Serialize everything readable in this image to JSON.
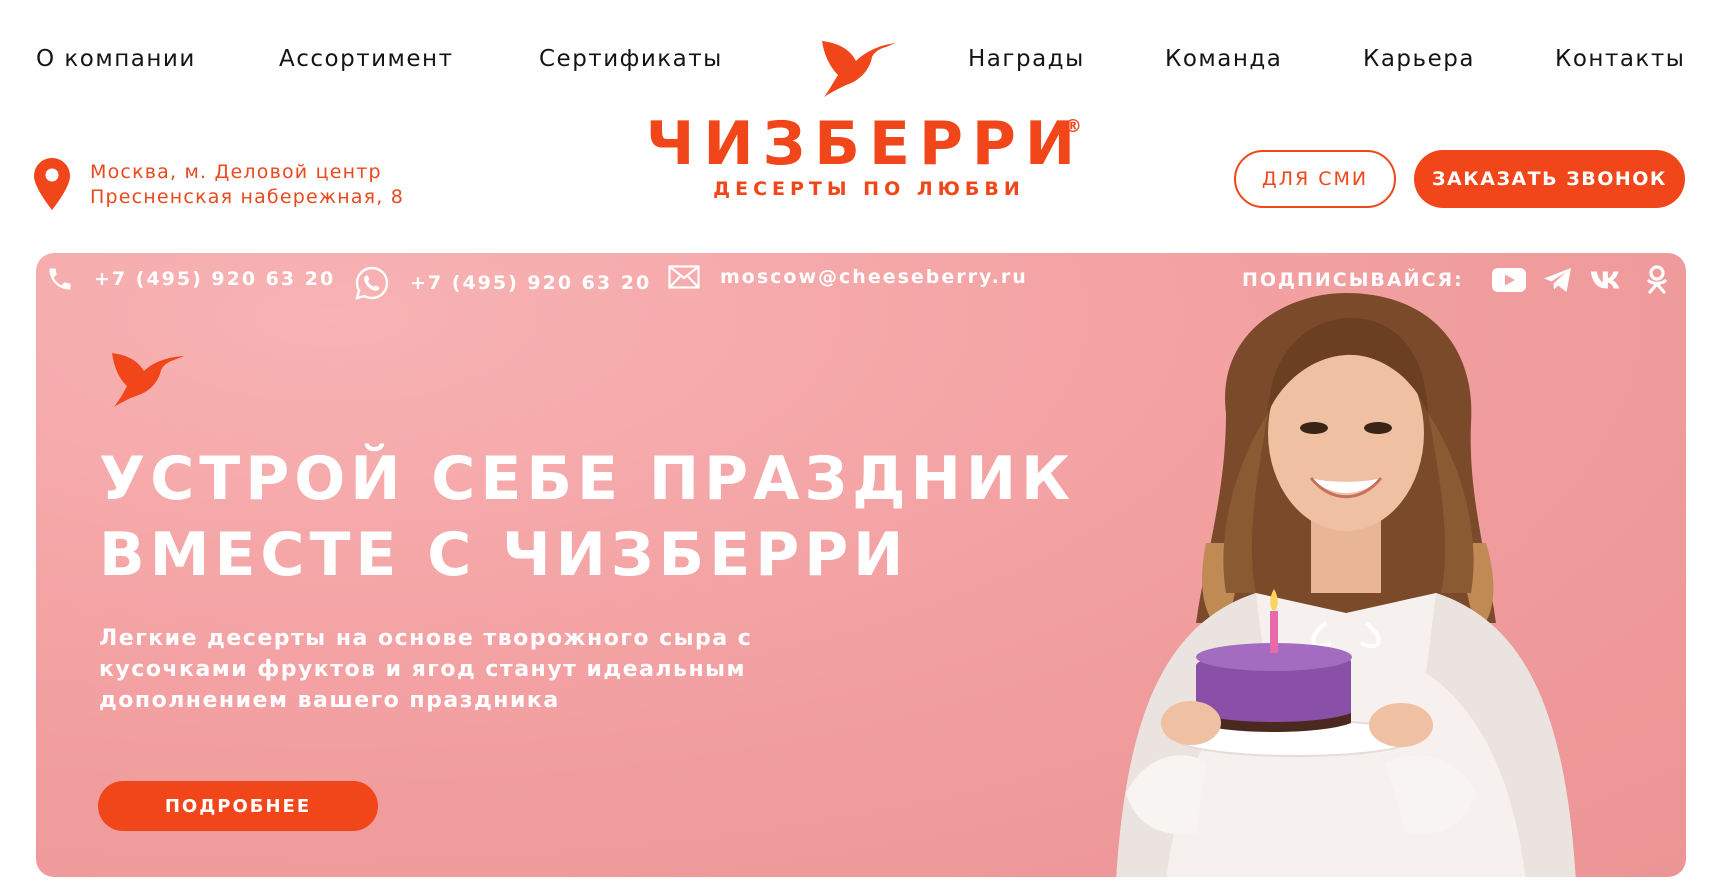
{
  "nav": {
    "left": [
      "О компании",
      "Ассортимент",
      "Сертификаты"
    ],
    "right": [
      "Награды",
      "Команда",
      "Карьера",
      "Контакты"
    ]
  },
  "brand": {
    "name": "ЧИЗБЕРРИ",
    "reg": "®",
    "tagline": "ДЕСЕРТЫ ПО ЛЮБВИ"
  },
  "address": {
    "line1": "Москва, м. Деловой центр",
    "line2": "Пресненская набережная, 8"
  },
  "header_buttons": {
    "press": "ДЛЯ СМИ",
    "callback": "ЗАКАЗАТЬ ЗВОНОК"
  },
  "contacts": {
    "phone": "+7 (495) 920 63 20",
    "whatsapp": "+7 (495) 920 63 20",
    "email": "moscow@cheeseberry.ru",
    "subscribe_label": "ПОДПИСЫВАЙСЯ:",
    "socials": [
      "youtube-icon",
      "telegram-icon",
      "vk-icon",
      "odnoklassniki-icon"
    ]
  },
  "hero": {
    "title_line1": "УСТРОЙ СЕБЕ ПРАЗДНИК",
    "title_line2": "ВМЕСТЕ С ЧИЗБЕРРИ",
    "text_line1": "Легкие десерты на основе творожного сыра с",
    "text_line2": "кусочками фруктов и ягод станут идеальным",
    "text_line3": "дополнением вашего праздника",
    "button": "ПОДРОБНЕЕ"
  },
  "colors": {
    "accent": "#f1461a",
    "hero_bg": "#f4a3a4",
    "text_dark": "#141414"
  }
}
